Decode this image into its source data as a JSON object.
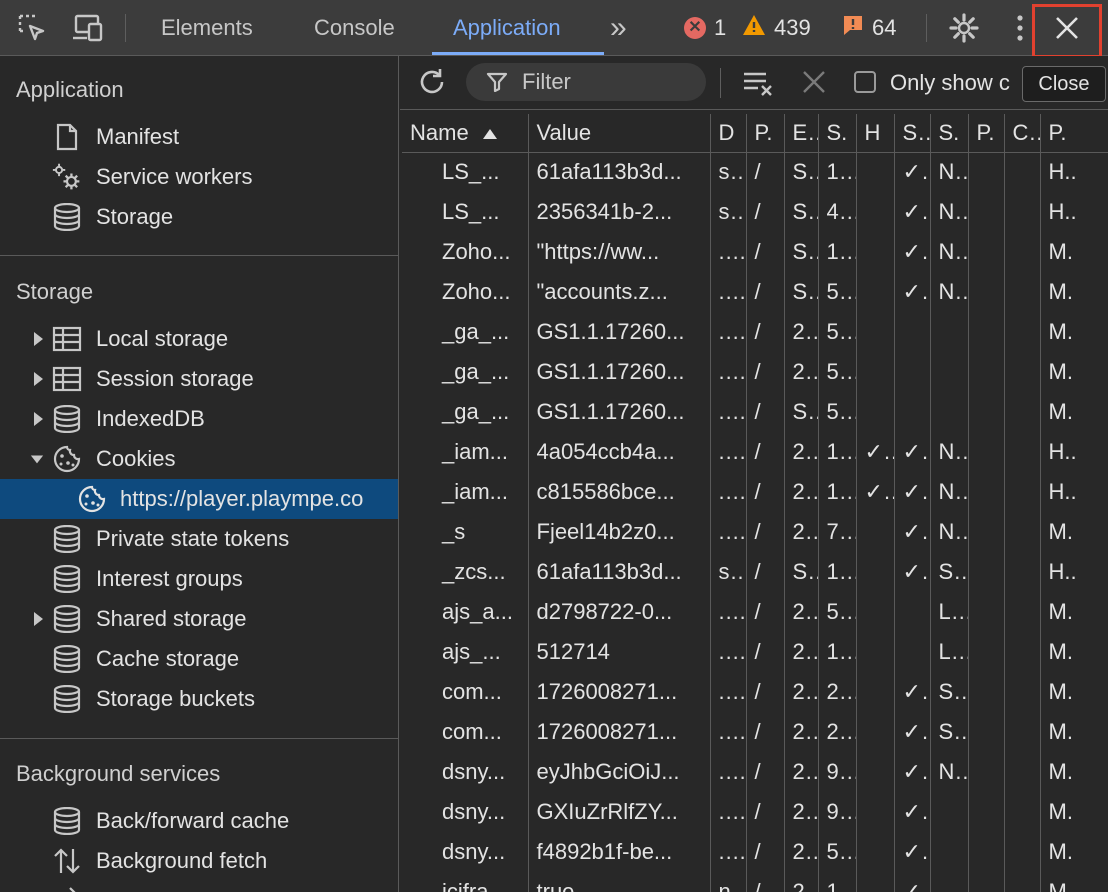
{
  "toolbar": {
    "tabs": [
      {
        "label": "Elements"
      },
      {
        "label": "Console"
      },
      {
        "label": "Application"
      }
    ],
    "more_tabs": "»",
    "errors": "1",
    "warnings": "439",
    "issues": "64"
  },
  "tooltip": "Close",
  "sidebar": {
    "application_title": "Application",
    "application_items": [
      {
        "label": "Manifest"
      },
      {
        "label": "Service workers"
      },
      {
        "label": "Storage"
      }
    ],
    "storage_title": "Storage",
    "storage_items": [
      {
        "label": "Local storage"
      },
      {
        "label": "Session storage"
      },
      {
        "label": "IndexedDB"
      },
      {
        "label": "Cookies"
      },
      {
        "label": "https://player.plaympe.co"
      },
      {
        "label": "Private state tokens"
      },
      {
        "label": "Interest groups"
      },
      {
        "label": "Shared storage"
      },
      {
        "label": "Cache storage"
      },
      {
        "label": "Storage buckets"
      }
    ],
    "background_title": "Background services",
    "background_items": [
      {
        "label": "Back/forward cache"
      },
      {
        "label": "Background fetch"
      }
    ]
  },
  "subbar": {
    "filter_placeholder": "Filter",
    "only_show_label": "Only show c"
  },
  "table": {
    "headers": [
      "Name",
      "Value",
      "D",
      "P.",
      "E.",
      "S.",
      "H",
      "S.",
      "S.",
      "P.",
      "C.",
      "P."
    ],
    "rows": [
      [
        "LS_...",
        "61afa113b3d...",
        "s..",
        "/",
        "S..",
        "1...",
        "",
        "✓.",
        "N..",
        "",
        "",
        "H.."
      ],
      [
        "LS_...",
        "2356341b-2...",
        "s..",
        "/",
        "S..",
        "4...",
        "",
        "✓.",
        "N..",
        "",
        "",
        "H.."
      ],
      [
        "Zoho...",
        "\"https://ww...",
        "....",
        "/",
        "S..",
        "1...",
        "",
        "✓.",
        "N..",
        "",
        "",
        "M."
      ],
      [
        "Zoho...",
        "\"accounts.z...",
        "....",
        "/",
        "S..",
        "5...",
        "",
        "✓.",
        "N..",
        "",
        "",
        "M."
      ],
      [
        "_ga_...",
        "GS1.1.17260...",
        "....",
        "/",
        "2..",
        "5...",
        "",
        "",
        "",
        "",
        "",
        "M."
      ],
      [
        "_ga_...",
        "GS1.1.17260...",
        "....",
        "/",
        "2..",
        "5...",
        "",
        "",
        "",
        "",
        "",
        "M."
      ],
      [
        "_ga_...",
        "GS1.1.17260...",
        "....",
        "/",
        "S..",
        "5...",
        "",
        "",
        "",
        "",
        "",
        "M."
      ],
      [
        "_iam...",
        "4a054ccb4a...",
        "....",
        "/",
        "2..",
        "1...",
        "✓.",
        "✓.",
        "N..",
        "",
        "",
        "H.."
      ],
      [
        "_iam...",
        "c815586bce...",
        "....",
        "/",
        "2..",
        "1...",
        "✓.",
        "✓.",
        "N..",
        "",
        "",
        "H.."
      ],
      [
        "_s",
        "Fjeel14b2z0...",
        "....",
        "/",
        "2..",
        "7...",
        "",
        "✓.",
        "N..",
        "",
        "",
        "M."
      ],
      [
        "_zcs...",
        "61afa113b3d...",
        "s..",
        "/",
        "S..",
        "1...",
        "",
        "✓.",
        "S..",
        "",
        "",
        "H.."
      ],
      [
        "ajs_a...",
        "d2798722-0...",
        "....",
        "/",
        "2..",
        "5...",
        "",
        "",
        "L..",
        "",
        "",
        "M."
      ],
      [
        "ajs_...",
        "512714",
        "....",
        "/",
        "2..",
        "1...",
        "",
        "",
        "L..",
        "",
        "",
        "M."
      ],
      [
        "com...",
        "1726008271...",
        "....",
        "/",
        "2..",
        "2...",
        "",
        "✓.",
        "S..",
        "",
        "",
        "M."
      ],
      [
        "com...",
        "1726008271...",
        "....",
        "/",
        "2..",
        "2...",
        "",
        "✓.",
        "S..",
        "",
        "",
        "M."
      ],
      [
        "dsny...",
        "eyJhbGciOiJ...",
        "....",
        "/",
        "2..",
        "9...",
        "",
        "✓.",
        "N..",
        "",
        "",
        "M."
      ],
      [
        "dsny...",
        "GXIuZrRlfZY...",
        "....",
        "/",
        "2..",
        "9...",
        "",
        "✓.",
        "",
        "",
        "",
        "M."
      ],
      [
        "dsny...",
        "f4892b1f-be...",
        "....",
        "/",
        "2..",
        "5...",
        "",
        "✓.",
        "",
        "",
        "",
        "M."
      ],
      [
        "icifra...",
        "true",
        "n..",
        "/",
        "2..",
        "1...",
        "",
        "✓.",
        "",
        "",
        "",
        "M."
      ]
    ]
  }
}
